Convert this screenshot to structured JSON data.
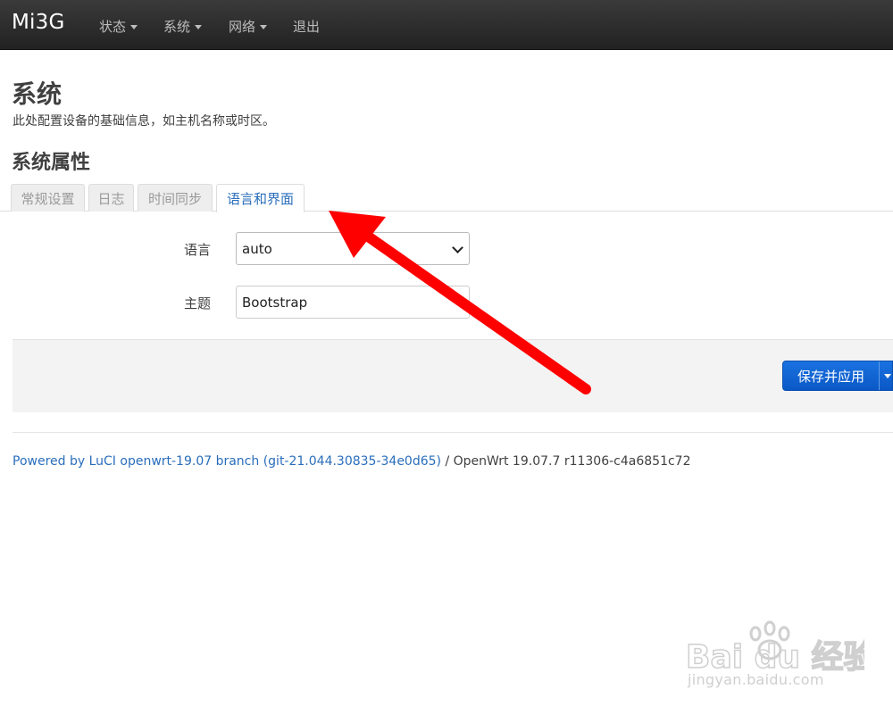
{
  "navbar": {
    "brand": "Mi3G",
    "items": [
      {
        "label": "状态",
        "has_caret": true
      },
      {
        "label": "系统",
        "has_caret": true
      },
      {
        "label": "网络",
        "has_caret": true
      },
      {
        "label": "退出",
        "has_caret": false
      }
    ]
  },
  "page": {
    "title": "系统",
    "description": "此处配置设备的基础信息，如主机名称或时区。",
    "section_title": "系统属性"
  },
  "tabs": [
    {
      "label": "常规设置",
      "active": false
    },
    {
      "label": "日志",
      "active": false
    },
    {
      "label": "时间同步",
      "active": false
    },
    {
      "label": "语言和界面",
      "active": true
    }
  ],
  "form": {
    "language": {
      "label": "语言",
      "value": "auto"
    },
    "theme": {
      "label": "主题",
      "value": "Bootstrap"
    }
  },
  "actions": {
    "save_apply_label": "保存并应用"
  },
  "footer": {
    "link_text": "Powered by LuCI openwrt-19.07 branch (git-21.044.30835-34e0d65)",
    "version_text": " / OpenWrt 19.07.7 r11306-c4a6851c72"
  },
  "watermark": {
    "logo_text": "Bai du 经验",
    "url_text": "jingyan.baidu.com"
  },
  "colors": {
    "navbar_bg": "#2b2b2b",
    "link": "#2a6ebb",
    "primary_button": "#0a58c6",
    "annotation_arrow": "#ff0000"
  }
}
